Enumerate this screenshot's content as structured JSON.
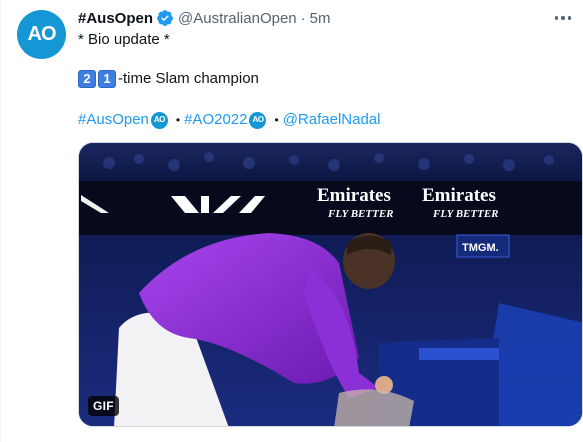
{
  "tweet": {
    "display_name": "#AusOpen",
    "handle": "@AustralianOpen",
    "separator": "·",
    "time": "5m",
    "avatar_text": "AO",
    "line1": "* Bio update *",
    "line2": {
      "digit1": "2",
      "digit2": "1",
      "text": "-time Slam champion"
    },
    "tags": {
      "tag1": "#AusOpen",
      "tag2": "#AO2022",
      "mention": "@RafaelNadal",
      "separator": "•",
      "badge_text": "AO"
    },
    "media": {
      "badge": "GIF",
      "signage": {
        "sponsor1_line1": "Emirates",
        "sponsor1_line2": "FLY BETTER",
        "sponsor2_line1": "Emirates",
        "sponsor2_line2": "FLY BETTER",
        "screen_text": "TMGM."
      }
    }
  },
  "colors": {
    "accent": "#1d9bf0",
    "brand": "#1597d5",
    "secondary_text": "#536471",
    "shirt": "#8b2fd6"
  },
  "icons": {
    "verified": "verified-badge-icon",
    "more": "more-icon"
  }
}
